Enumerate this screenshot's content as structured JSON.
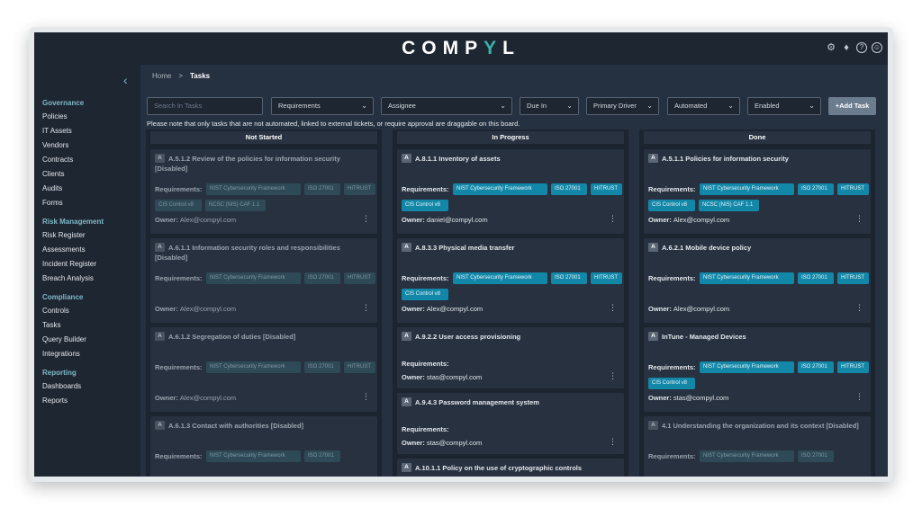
{
  "brand": {
    "logo_pre": "COMP",
    "logo_accent": "Y",
    "logo_post": "L"
  },
  "top_icons": [
    "gear-icon",
    "bell-icon",
    "help-icon",
    "user-icon"
  ],
  "breadcrumb": {
    "home": "Home",
    "separator": ">",
    "current": "Tasks"
  },
  "sidebar": {
    "groups": [
      {
        "title": "Governance",
        "items": [
          "Policies",
          "IT Assets",
          "Vendors",
          "Contracts",
          "Clients",
          "Audits",
          "Forms"
        ]
      },
      {
        "title": "Risk Management",
        "items": [
          "Risk Register",
          "Assessments",
          "Incident Register",
          "Breach Analysis"
        ]
      },
      {
        "title": "Compliance",
        "items": [
          "Controls",
          "Tasks",
          "Query Builder",
          "Integrations"
        ]
      },
      {
        "title": "Reporting",
        "items": [
          "Dashboards",
          "Reports"
        ]
      }
    ]
  },
  "toolbar": {
    "search_placeholder": "Search In Tasks",
    "requirements": "Requirements",
    "assignee": "Assignee",
    "due_in": "Due In",
    "primary_driver": "Primary Driver",
    "automated": "Automated",
    "enabled": "Enabled",
    "add_task": "+Add Task"
  },
  "notice": "Please note that only tasks that are not automated, linked to external tickets, or require approval are draggable on this board.",
  "labels": {
    "requirements": "Requirements:",
    "owner": "Owner:",
    "badge": "A"
  },
  "columns": [
    {
      "title": "Not Started",
      "cards": [
        {
          "title": "A.5.1.2 Review of the policies for information security [Disabled]",
          "disabled": true,
          "tags": [
            "NIST Cybersecurity Framework",
            "ISO 27001",
            "HITRUST",
            "CIS Control v8",
            "NCSC (NIS) CAF 1.1"
          ],
          "owner": "Alex@compyl.com"
        },
        {
          "title": "A.6.1.1 Information security roles and responsibilities [Disabled]",
          "disabled": true,
          "tags": [
            "NIST Cybersecurity Framework",
            "ISO 27001",
            "HITRUST"
          ],
          "owner": "Alex@compyl.com"
        },
        {
          "title": "A.6.1.2 Segregation of duties [Disabled]",
          "disabled": true,
          "tags": [
            "NIST Cybersecurity Framework",
            "ISO 27001",
            "HITRUST"
          ],
          "owner": "Alex@compyl.com"
        },
        {
          "title": "A.6.1.3 Contact with authorities [Disabled]",
          "disabled": true,
          "tags": [
            "NIST Cybersecurity Framework",
            "ISO 27001"
          ],
          "owner": ""
        }
      ]
    },
    {
      "title": "In Progress",
      "cards": [
        {
          "title": "A.8.1.1 Inventory of assets",
          "disabled": false,
          "tags": [
            "NIST Cybersecurity Framework",
            "ISO 27001",
            "HITRUST",
            "CIS Control v8"
          ],
          "owner": "daniel@compyl.com"
        },
        {
          "title": "A.8.3.3 Physical media transfer",
          "disabled": false,
          "tags": [
            "NIST Cybersecurity Framework",
            "ISO 27001",
            "HITRUST",
            "CIS Control v8"
          ],
          "owner": "Alex@compyl.com"
        },
        {
          "title": "A.9.2.2 User access provisioning",
          "disabled": false,
          "tags": [],
          "owner": "stas@compyl.com"
        },
        {
          "title": "A.9.4.3 Password management system",
          "disabled": false,
          "tags": [],
          "owner": "stas@compyl.com"
        },
        {
          "title": "A.10.1.1 Policy on the use of cryptographic controls",
          "disabled": false,
          "tags": [],
          "owner": ""
        }
      ]
    },
    {
      "title": "Done",
      "cards": [
        {
          "title": "A.5.1.1 Policies for information security",
          "disabled": false,
          "tags": [
            "NIST Cybersecurity Framework",
            "ISO 27001",
            "HITRUST",
            "CIS Control v8",
            "NCSC (NIS) CAF 1.1"
          ],
          "owner": "Alex@compyl.com"
        },
        {
          "title": "A.6.2.1 Mobile device policy",
          "disabled": false,
          "tags": [
            "NIST Cybersecurity Framework",
            "ISO 27001",
            "HITRUST"
          ],
          "owner": "Alex@compyl.com"
        },
        {
          "title": "InTune - Managed Devices",
          "disabled": false,
          "tags": [
            "NIST Cybersecurity Framework",
            "ISO 27001",
            "HITRUST",
            "CIS Control v8"
          ],
          "owner": "stas@compyl.com"
        },
        {
          "title": "4.1 Understanding the organization and its context [Disabled]",
          "disabled": true,
          "tags": [
            "NIST Cybersecurity Framework",
            "ISO 27001"
          ],
          "owner": ""
        }
      ]
    }
  ]
}
